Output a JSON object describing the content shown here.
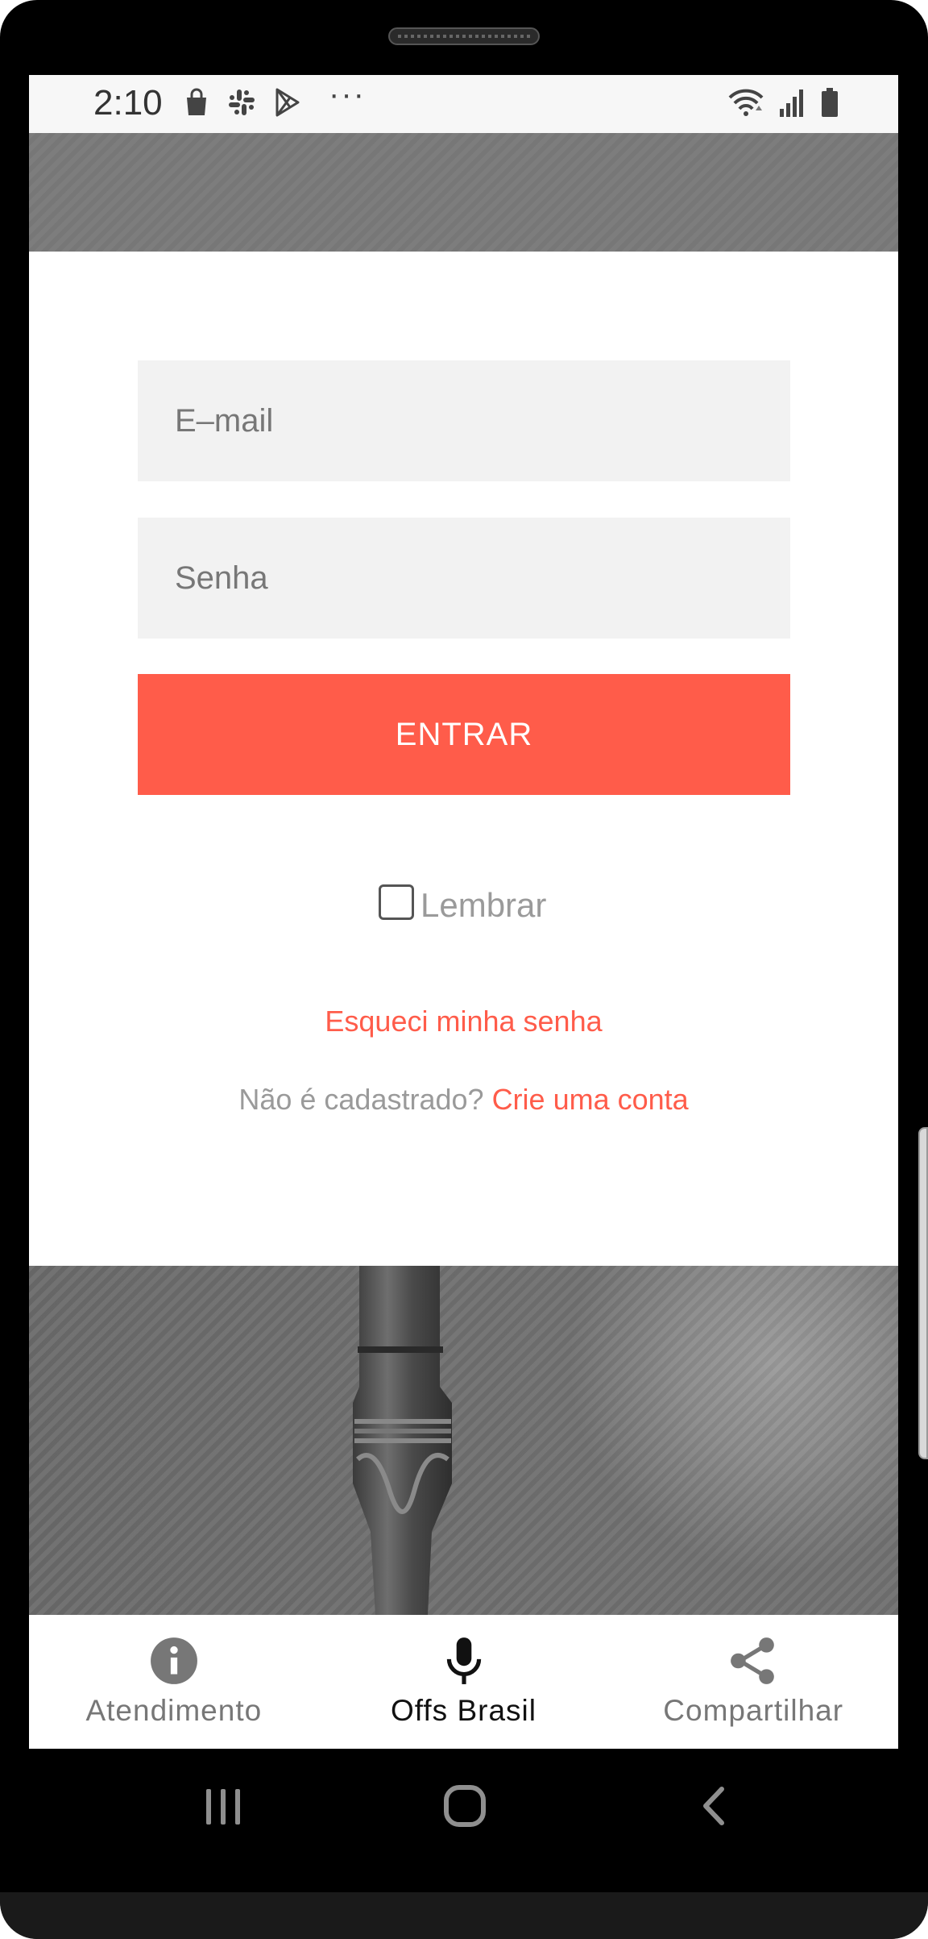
{
  "status_bar": {
    "time": "2:10",
    "left_icons": [
      "shopping-bag-icon",
      "slack-icon",
      "play-store-icon"
    ],
    "overflow": "···",
    "right_icons": [
      "wifi-icon",
      "signal-icon",
      "battery-icon"
    ]
  },
  "login": {
    "email_placeholder": "E–mail",
    "password_placeholder": "Senha",
    "submit_label": "ENTRAR",
    "remember_label": "Lembrar",
    "remember_checked": false,
    "forgot_password": "Esqueci minha senha",
    "signup_prompt": "Não é cadastrado?",
    "signup_link": "Crie uma conta"
  },
  "bottom_nav": {
    "items": [
      {
        "label": "Atendimento",
        "icon": "info-icon",
        "active": false
      },
      {
        "label": "Offs Brasil",
        "icon": "microphone-icon",
        "active": true
      },
      {
        "label": "Compartilhar",
        "icon": "share-icon",
        "active": false
      }
    ]
  },
  "system_nav": [
    "recents-icon",
    "home-icon",
    "back-icon"
  ],
  "colors": {
    "accent": "#ff5c4a",
    "field_bg": "#f2f2f2",
    "muted_text": "#9a9a9a",
    "nav_inactive": "#777777",
    "nav_active": "#111111"
  }
}
